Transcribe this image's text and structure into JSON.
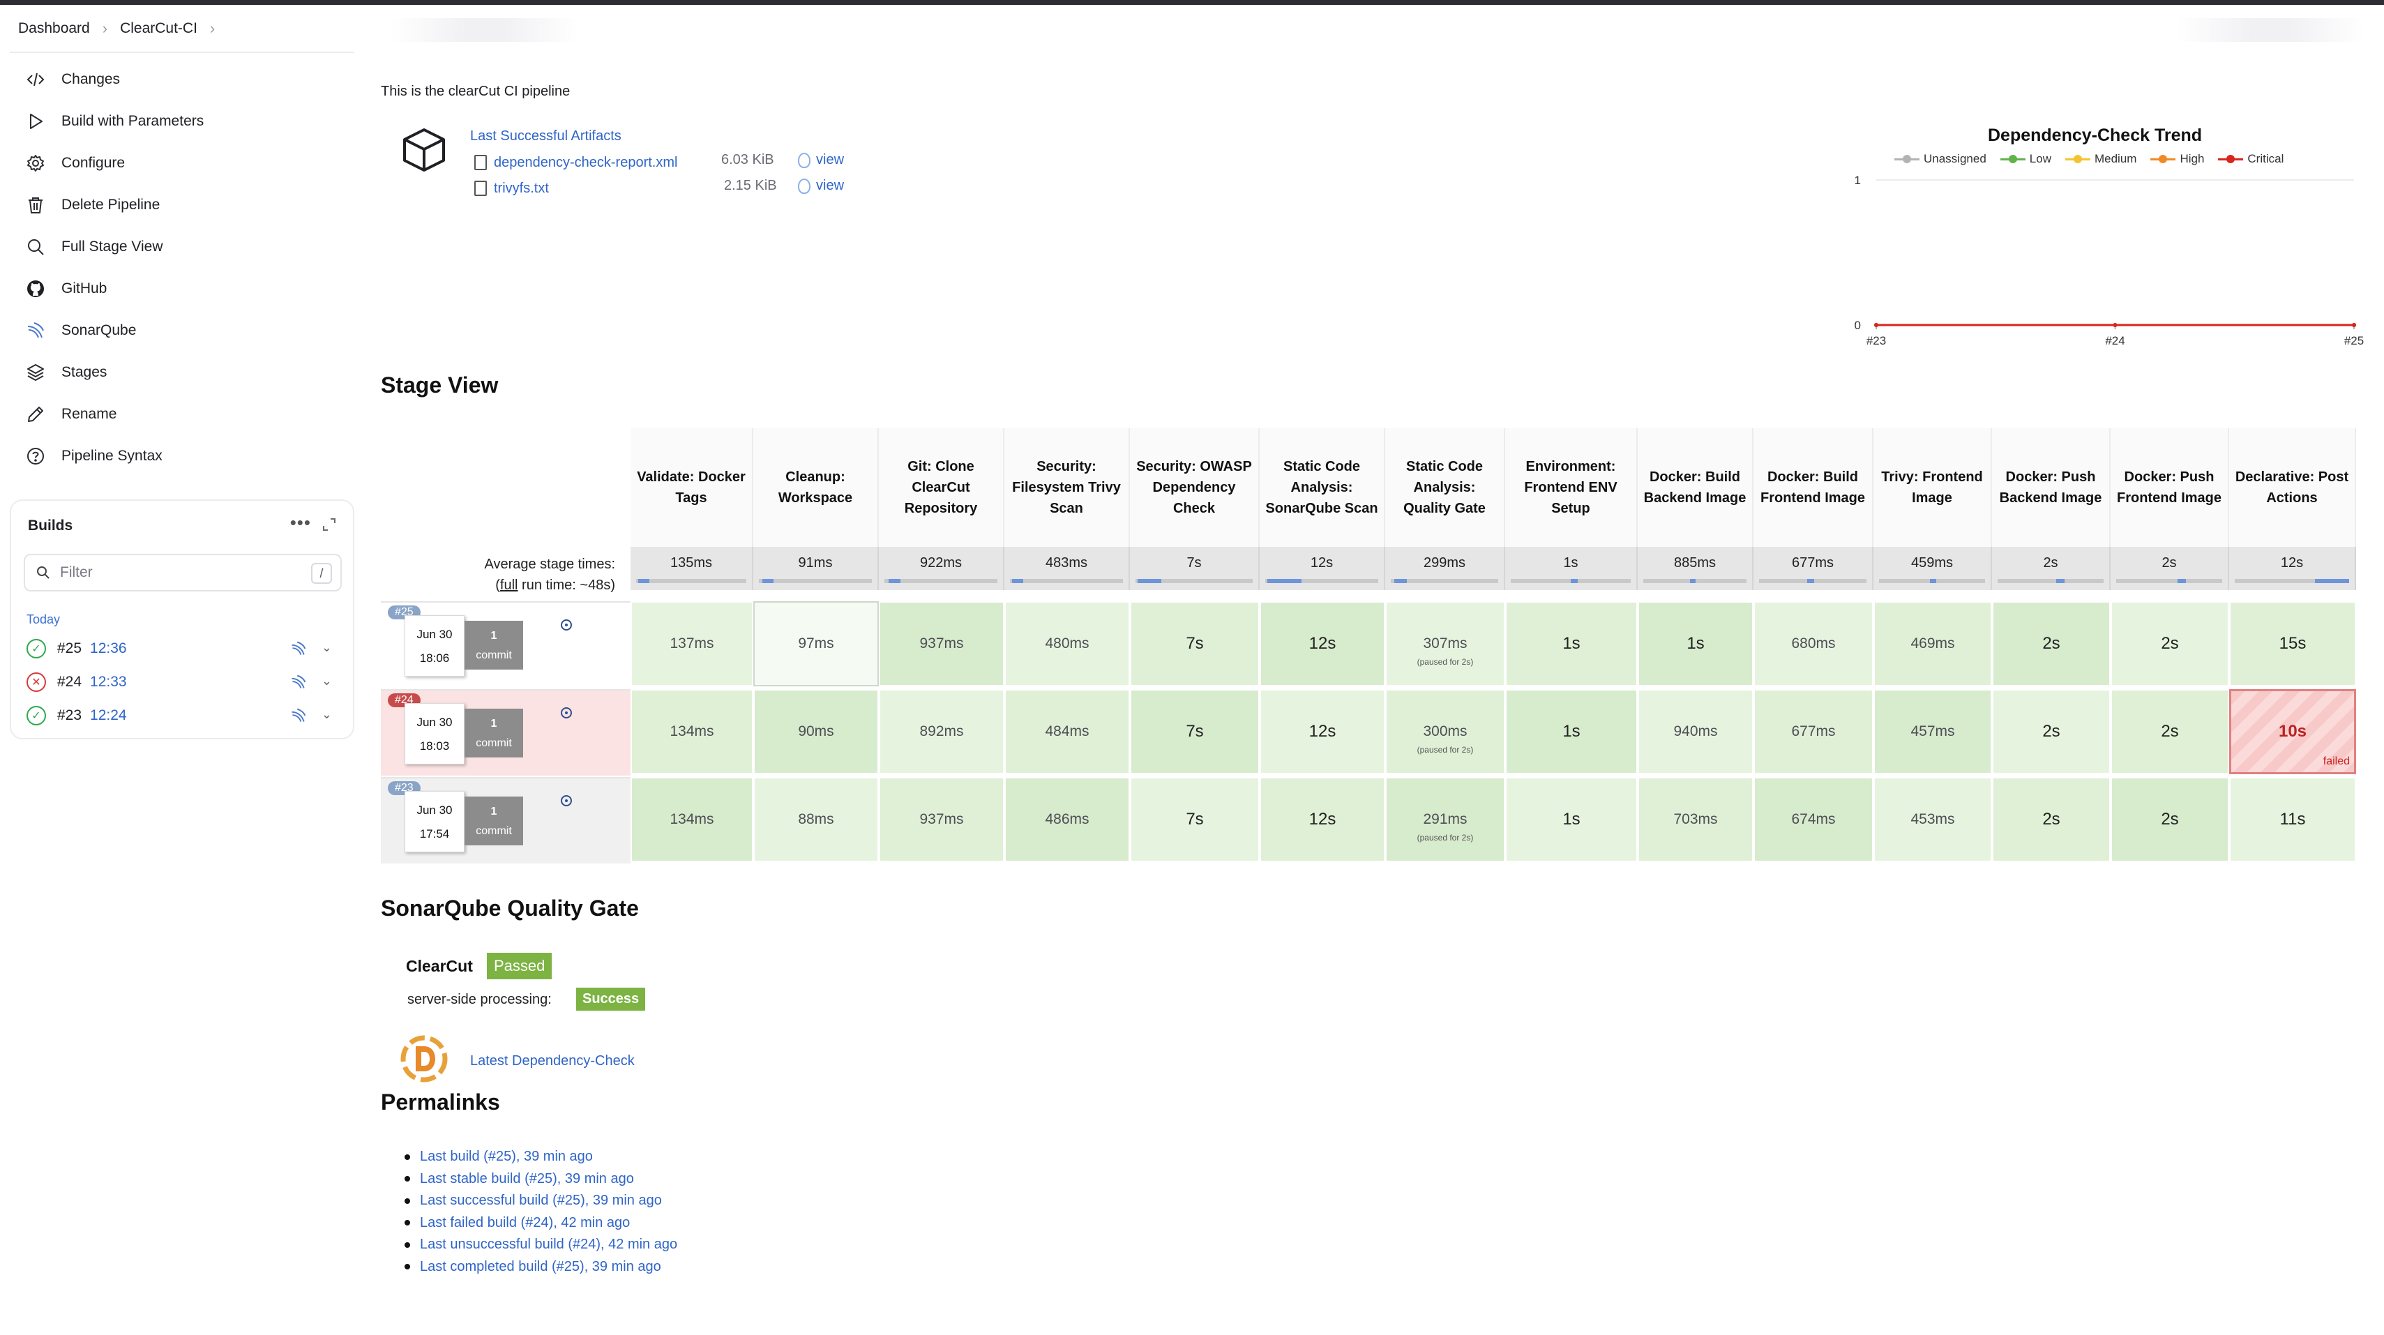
{
  "breadcrumb": [
    "Dashboard",
    "ClearCut-CI"
  ],
  "sidebar": {
    "items": [
      {
        "label": "Changes",
        "icon": "code-icon"
      },
      {
        "label": "Build with Parameters",
        "icon": "play-icon"
      },
      {
        "label": "Configure",
        "icon": "gear-icon"
      },
      {
        "label": "Delete Pipeline",
        "icon": "trash-icon"
      },
      {
        "label": "Full Stage View",
        "icon": "search-icon"
      },
      {
        "label": "GitHub",
        "icon": "github-icon"
      },
      {
        "label": "SonarQube",
        "icon": "sonarqube-icon"
      },
      {
        "label": "Stages",
        "icon": "stack-icon"
      },
      {
        "label": "Rename",
        "icon": "pencil-icon"
      },
      {
        "label": "Pipeline Syntax",
        "icon": "help-icon"
      }
    ]
  },
  "builds": {
    "title": "Builds",
    "filter_placeholder": "Filter",
    "filter_shortcut": "/",
    "group": "Today",
    "list": [
      {
        "number": "#25",
        "time": "12:36",
        "status": "success"
      },
      {
        "number": "#24",
        "time": "12:33",
        "status": "failed"
      },
      {
        "number": "#23",
        "time": "12:24",
        "status": "success"
      }
    ]
  },
  "description": "This is the clearCut CI pipeline",
  "artifacts": {
    "title": "Last Successful Artifacts",
    "files": [
      {
        "name": "dependency-check-report.xml",
        "size": "6.03 KiB",
        "action": "view"
      },
      {
        "name": "trivyfs.txt",
        "size": "2.15 KiB",
        "action": "view"
      }
    ]
  },
  "chart_data": {
    "type": "line",
    "title": "Dependency-Check Trend",
    "categories": [
      "#23",
      "#24",
      "#25"
    ],
    "series": [
      {
        "name": "Unassigned",
        "color": "#b3b3b3",
        "values": [
          0,
          0,
          0
        ]
      },
      {
        "name": "Low",
        "color": "#5fb34a",
        "values": [
          0,
          0,
          0
        ]
      },
      {
        "name": "Medium",
        "color": "#f4c430",
        "values": [
          0,
          0,
          0
        ]
      },
      {
        "name": "High",
        "color": "#f08a24",
        "values": [
          0,
          0,
          0
        ]
      },
      {
        "name": "Critical",
        "color": "#d9261c",
        "values": [
          0,
          0,
          0
        ]
      }
    ],
    "ylim": [
      0,
      1
    ],
    "yticks": [
      "0",
      "1"
    ],
    "legend": "top"
  },
  "stage_view": {
    "title": "Stage View",
    "avg_label": "Average stage times:",
    "full_label_prefix": "(",
    "full_label_link": "full",
    "full_label_suffix": " run time: ~48s)",
    "stages": [
      {
        "name": "Validate: Docker Tags",
        "avg": "135ms"
      },
      {
        "name": "Cleanup: Workspace",
        "avg": "91ms"
      },
      {
        "name": "Git: Clone ClearCut Repository",
        "avg": "922ms"
      },
      {
        "name": "Security: Filesystem Trivy Scan",
        "avg": "483ms"
      },
      {
        "name": "Security: OWASP Dependency Check",
        "avg": "7s"
      },
      {
        "name": "Static Code Analysis: SonarQube Scan",
        "avg": "12s"
      },
      {
        "name": "Static Code Analysis: Quality Gate",
        "avg": "299ms"
      },
      {
        "name": "Environment: Frontend ENV Setup",
        "avg": "1s"
      },
      {
        "name": "Docker: Build Backend Image",
        "avg": "885ms"
      },
      {
        "name": "Docker: Build Frontend Image",
        "avg": "677ms"
      },
      {
        "name": "Trivy: Frontend Image",
        "avg": "459ms"
      },
      {
        "name": "Docker: Push Backend Image",
        "avg": "2s"
      },
      {
        "name": "Docker: Push Frontend Image",
        "avg": "2s"
      },
      {
        "name": "Declarative: Post Actions",
        "avg": "12s"
      }
    ],
    "runs": [
      {
        "badge": "#25",
        "date": "Jun 30",
        "time": "18:06",
        "commits": "1",
        "commit_label": "commit",
        "cells": [
          "137ms",
          "97ms",
          "937ms",
          "480ms",
          "7s",
          "12s",
          "307ms",
          "1s",
          "1s",
          "680ms",
          "469ms",
          "2s",
          "2s",
          "15s"
        ],
        "note": "(paused for 2s)"
      },
      {
        "badge": "#24",
        "date": "Jun 30",
        "time": "18:03",
        "commits": "1",
        "commit_label": "commit",
        "cells": [
          "134ms",
          "90ms",
          "892ms",
          "484ms",
          "7s",
          "12s",
          "300ms",
          "1s",
          "940ms",
          "677ms",
          "457ms",
          "2s",
          "2s",
          "10s"
        ],
        "note": "(paused for 2s)",
        "failed_label": "failed"
      },
      {
        "badge": "#23",
        "date": "Jun 30",
        "time": "17:54",
        "commits": "1",
        "commit_label": "commit",
        "cells": [
          "134ms",
          "88ms",
          "937ms",
          "486ms",
          "7s",
          "12s",
          "291ms",
          "1s",
          "703ms",
          "674ms",
          "453ms",
          "2s",
          "2s",
          "11s"
        ],
        "note": "(paused for 2s)"
      }
    ]
  },
  "sonarqube": {
    "title": "SonarQube Quality Gate",
    "project": "ClearCut",
    "status": "Passed",
    "processing_label": "server-side processing:",
    "processing_status": "Success"
  },
  "dependency_check_link": "Latest Dependency-Check",
  "permalinks": {
    "title": "Permalinks",
    "items": [
      "Last build (#25), 39 min ago",
      "Last stable build (#25), 39 min ago",
      "Last successful build (#25), 39 min ago",
      "Last failed build (#24), 42 min ago",
      "Last unsuccessful build (#24), 42 min ago",
      "Last completed build (#25), 39 min ago"
    ]
  }
}
